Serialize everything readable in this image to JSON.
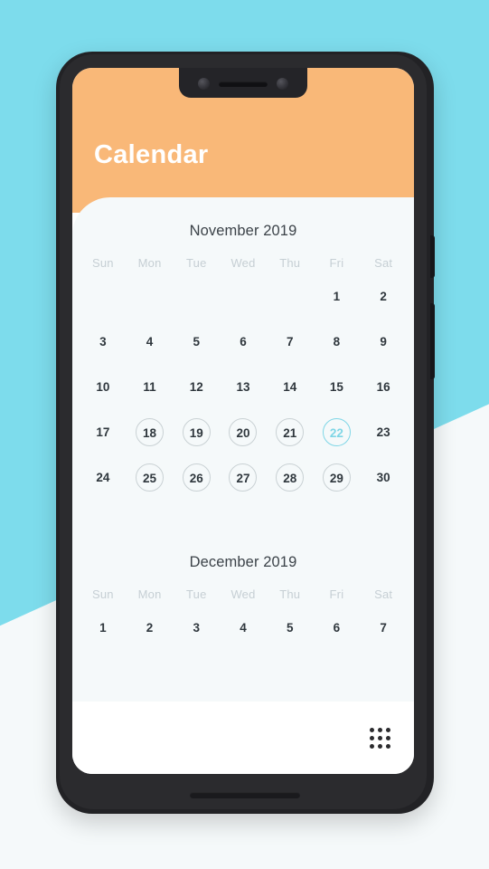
{
  "app": {
    "title": "Calendar",
    "accent_orange": "#f9b878",
    "accent_cyan": "#7fd6e6",
    "background_cyan": "#7ddcec",
    "card_background": "#f5f9fa"
  },
  "weekdays": [
    "Sun",
    "Mon",
    "Tue",
    "Wed",
    "Thu",
    "Fri",
    "Sat"
  ],
  "months": [
    {
      "title": "November 2019",
      "weeks": [
        [
          {
            "label": "",
            "style": "empty"
          },
          {
            "label": "",
            "style": "empty"
          },
          {
            "label": "",
            "style": "empty"
          },
          {
            "label": "",
            "style": "empty"
          },
          {
            "label": "",
            "style": "empty"
          },
          {
            "label": "1",
            "style": "plain"
          },
          {
            "label": "2",
            "style": "plain"
          }
        ],
        [
          {
            "label": "3",
            "style": "plain"
          },
          {
            "label": "4",
            "style": "plain"
          },
          {
            "label": "5",
            "style": "plain"
          },
          {
            "label": "6",
            "style": "plain"
          },
          {
            "label": "7",
            "style": "plain"
          },
          {
            "label": "8",
            "style": "plain"
          },
          {
            "label": "9",
            "style": "plain"
          }
        ],
        [
          {
            "label": "10",
            "style": "plain"
          },
          {
            "label": "11",
            "style": "plain"
          },
          {
            "label": "12",
            "style": "plain"
          },
          {
            "label": "13",
            "style": "plain"
          },
          {
            "label": "14",
            "style": "plain"
          },
          {
            "label": "15",
            "style": "plain"
          },
          {
            "label": "16",
            "style": "plain"
          }
        ],
        [
          {
            "label": "17",
            "style": "plain"
          },
          {
            "label": "18",
            "style": "circled"
          },
          {
            "label": "19",
            "style": "circled"
          },
          {
            "label": "20",
            "style": "circled"
          },
          {
            "label": "21",
            "style": "circled"
          },
          {
            "label": "22",
            "style": "selected"
          },
          {
            "label": "23",
            "style": "plain"
          }
        ],
        [
          {
            "label": "24",
            "style": "plain"
          },
          {
            "label": "25",
            "style": "circled"
          },
          {
            "label": "26",
            "style": "circled"
          },
          {
            "label": "27",
            "style": "circled"
          },
          {
            "label": "28",
            "style": "circled"
          },
          {
            "label": "29",
            "style": "circled"
          },
          {
            "label": "30",
            "style": "plain"
          }
        ]
      ]
    },
    {
      "title": "December 2019",
      "weeks": [
        [
          {
            "label": "1",
            "style": "plain"
          },
          {
            "label": "2",
            "style": "plain"
          },
          {
            "label": "3",
            "style": "plain"
          },
          {
            "label": "4",
            "style": "plain"
          },
          {
            "label": "5",
            "style": "plain"
          },
          {
            "label": "6",
            "style": "plain"
          },
          {
            "label": "7",
            "style": "plain"
          }
        ]
      ]
    }
  ],
  "bottom_bar": {
    "icon": "apps-grid-icon"
  }
}
